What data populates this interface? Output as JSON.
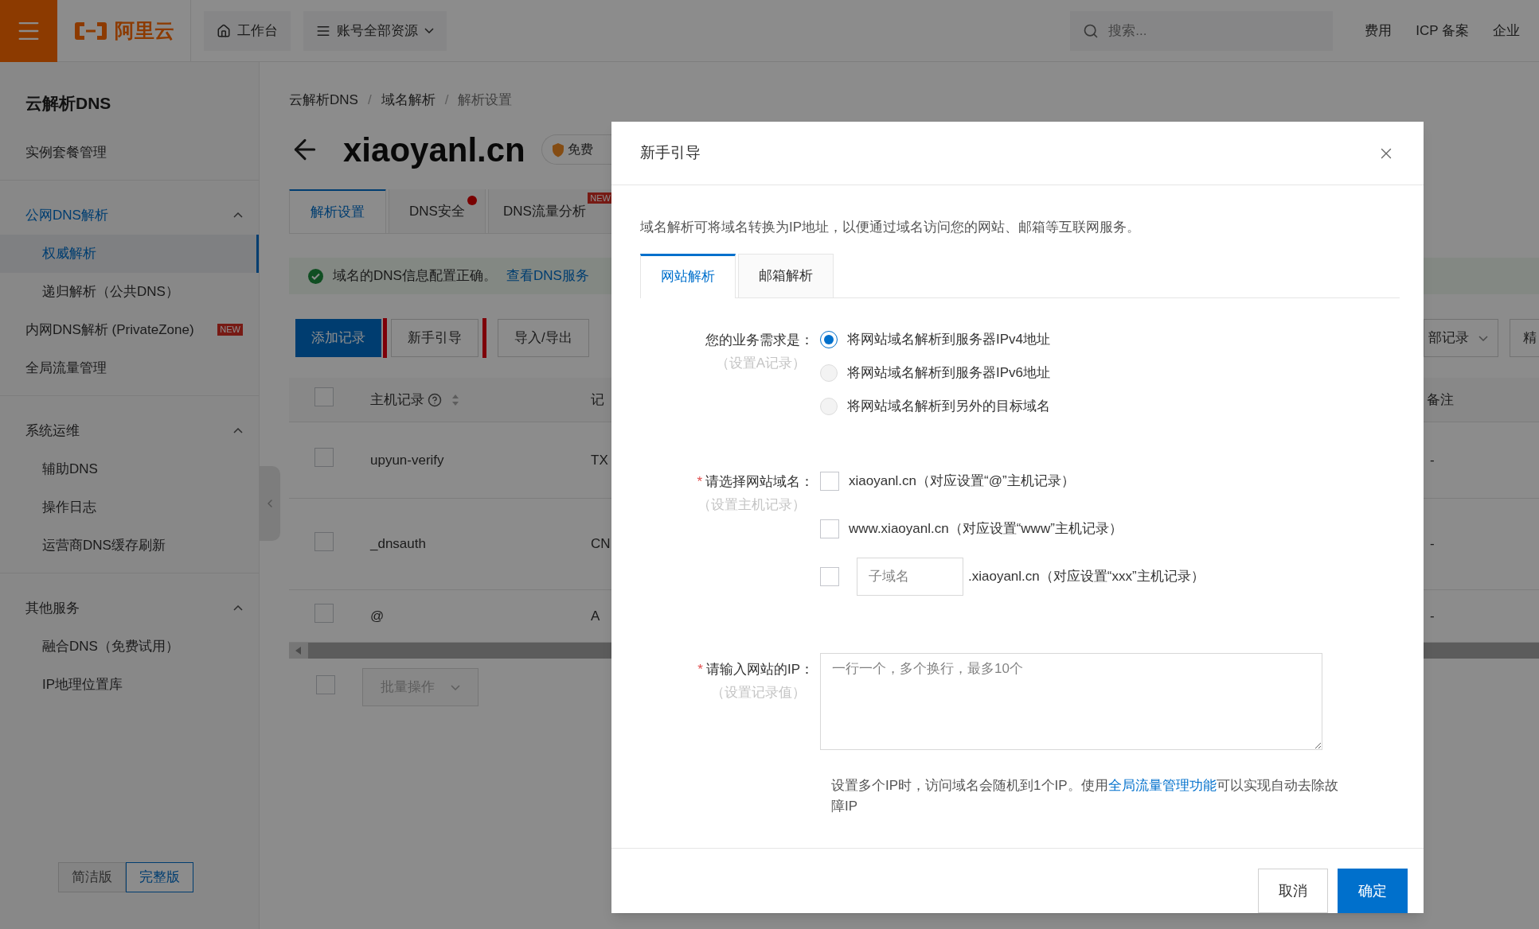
{
  "top_bar": {
    "logo": "阿里云",
    "workbench": "工作台",
    "resources": "账号全部资源",
    "search": {
      "placeholder": "搜索..."
    },
    "links": [
      "费用",
      "ICP 备案",
      "企业"
    ]
  },
  "sidebar": {
    "title": "云解析DNS",
    "sections": [
      {
        "items": [
          {
            "label": "实例套餐管理",
            "selected": false
          }
        ]
      },
      {
        "items": [
          {
            "label": "公网DNS解析",
            "expanded": true,
            "children": [
              {
                "label": "权威解析",
                "selected": true
              },
              {
                "label": "递归解析（公共DNS）",
                "selected": false
              }
            ]
          },
          {
            "label": "内网DNS解析 (PrivateZone)",
            "badge": "NEW",
            "selected": false
          },
          {
            "label": "全局流量管理",
            "selected": false
          }
        ]
      },
      {
        "items": [
          {
            "label": "系统运维",
            "expanded": true,
            "children": [
              {
                "label": "辅助DNS",
                "selected": false
              },
              {
                "label": "操作日志",
                "selected": false
              },
              {
                "label": "运营商DNS缓存刷新",
                "selected": false
              }
            ]
          }
        ]
      },
      {
        "items": [
          {
            "label": "其他服务",
            "expanded": true,
            "children": [
              {
                "label": "融合DNS（免费试用）",
                "selected": false
              },
              {
                "label": "IP地理位置库",
                "selected": false
              }
            ]
          }
        ]
      }
    ],
    "version_toggle": [
      {
        "label": "简洁版",
        "selected": false
      },
      {
        "label": "完整版",
        "selected": true
      }
    ]
  },
  "breadcrumb": {
    "separator": "/",
    "items": [
      "云解析DNS",
      "域名解析",
      "解析设置"
    ]
  },
  "domain": {
    "name": "xiaoyanl.cn",
    "badge": "免费"
  },
  "tabs": [
    {
      "label": "解析设置",
      "selected": true,
      "dot": false
    },
    {
      "label": "DNS安全",
      "selected": false,
      "dot": true
    },
    {
      "label": "DNS流量分析",
      "selected": false,
      "dot": false,
      "badge": "NEW"
    }
  ],
  "alert": {
    "text": "域名的DNS信息配置正确。",
    "link": "查看DNS服务"
  },
  "toolbar": {
    "buttons": [
      {
        "label": "添加记录",
        "kind": "primary",
        "highlighted": false
      },
      {
        "label": "新手引导",
        "kind": "default",
        "highlighted": true
      },
      {
        "label": "导入/导出",
        "kind": "default",
        "highlighted": false
      }
    ],
    "filter": "部记录",
    "search_button": "精"
  },
  "table": {
    "header_checked": false,
    "columns": [
      "主机记录",
      "记",
      "备注"
    ],
    "rows": [
      {
        "checked": false,
        "host": "upyun-verify",
        "type": "TX",
        "remark": "-"
      },
      {
        "checked": false,
        "host": "_dnsauth",
        "type": "CN",
        "remark": "-"
      },
      {
        "checked": false,
        "host": "@",
        "type": "A",
        "remark": "-"
      }
    ],
    "batch": {
      "checked": false,
      "label": "批量操作"
    }
  },
  "dialog": {
    "title": "新手引导",
    "description": "域名解析可将域名转换为IP地址，以便通过域名访问您的网站、邮箱等互联网服务。",
    "tabs": [
      {
        "label": "网站解析",
        "selected": true
      },
      {
        "label": "邮箱解析",
        "selected": false
      }
    ],
    "need": {
      "label": "您的业务需求是：",
      "hint": "（设置A记录）",
      "options": [
        {
          "label": "将网站域名解析到服务器IPv4地址",
          "selected": true
        },
        {
          "label": "将网站域名解析到服务器IPv6地址",
          "selected": false
        },
        {
          "label": "将网站域名解析到另外的目标域名",
          "selected": false
        }
      ]
    },
    "domains": {
      "label": "请选择网站域名：",
      "hint": "（设置主机记录）",
      "required_mark": "*",
      "options": [
        {
          "kind": "plain",
          "label": "xiaoyanl.cn（对应设置“@”主机记录）",
          "checked": false
        },
        {
          "kind": "plain",
          "label": "www.xiaoyanl.cn（对应设置“www”主机记录）",
          "checked": false
        },
        {
          "kind": "subdomain",
          "placeholder": "子域名",
          "label": ".xiaoyanl.cn（对应设置“xxx”主机记录）",
          "checked": false
        }
      ]
    },
    "ip": {
      "label": "请输入网站的IP：",
      "hint": "（设置记录值）",
      "required_mark": "*",
      "placeholder": "一行一个，多个换行，最多10个"
    },
    "note": {
      "before": "设置多个IP时，访问域名会随机到1个IP。使用",
      "link": "全局流量管理功能",
      "after": "可以实现自动去除故障IP"
    },
    "buttons": [
      {
        "label": "取消",
        "kind": "secondary"
      },
      {
        "label": "确定",
        "kind": "primary"
      }
    ]
  }
}
